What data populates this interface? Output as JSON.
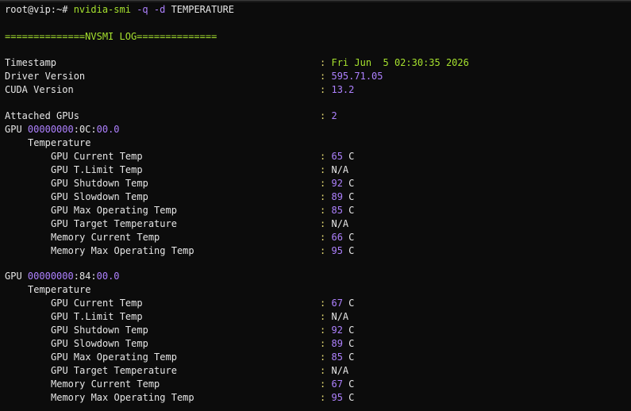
{
  "prompt": {
    "user_host": "root@vip",
    "path_symbol": ":~# ",
    "command": "nvidia-smi",
    "flag_q": "-q",
    "flag_d": "-d",
    "arg": "TEMPERATURE"
  },
  "header": "==============NVSMI LOG==============",
  "timestamp": {
    "label": "Timestamp",
    "value": "Fri Jun  5 02:30:35 2026"
  },
  "driver_version": {
    "label": "Driver Version",
    "value": "595.71.05"
  },
  "cuda_version": {
    "label": "CUDA Version",
    "value": "13.2"
  },
  "attached_gpus": {
    "label": "Attached GPUs",
    "value": "2"
  },
  "colon": ":",
  "gpus": [
    {
      "label": "GPU",
      "bus_prefix": "00000000",
      "bus_mid": ":0C:",
      "bus_suffix": "00.0",
      "section": "Temperature",
      "rows": [
        {
          "label": "GPU Current Temp",
          "num": "65",
          "unit": " C"
        },
        {
          "label": "GPU T.Limit Temp",
          "num": "",
          "unit": "N/A"
        },
        {
          "label": "GPU Shutdown Temp",
          "num": "92",
          "unit": " C"
        },
        {
          "label": "GPU Slowdown Temp",
          "num": "89",
          "unit": " C"
        },
        {
          "label": "GPU Max Operating Temp",
          "num": "85",
          "unit": " C"
        },
        {
          "label": "GPU Target Temperature",
          "num": "",
          "unit": "N/A"
        },
        {
          "label": "Memory Current Temp",
          "num": "66",
          "unit": " C"
        },
        {
          "label": "Memory Max Operating Temp",
          "num": "95",
          "unit": " C"
        }
      ]
    },
    {
      "label": "GPU",
      "bus_prefix": "00000000",
      "bus_mid": ":84:",
      "bus_suffix": "00.0",
      "section": "Temperature",
      "rows": [
        {
          "label": "GPU Current Temp",
          "num": "67",
          "unit": " C"
        },
        {
          "label": "GPU T.Limit Temp",
          "num": "",
          "unit": "N/A"
        },
        {
          "label": "GPU Shutdown Temp",
          "num": "92",
          "unit": " C"
        },
        {
          "label": "GPU Slowdown Temp",
          "num": "89",
          "unit": " C"
        },
        {
          "label": "GPU Max Operating Temp",
          "num": "85",
          "unit": " C"
        },
        {
          "label": "GPU Target Temperature",
          "num": "",
          "unit": "N/A"
        },
        {
          "label": "Memory Current Temp",
          "num": "67",
          "unit": " C"
        },
        {
          "label": "Memory Max Operating Temp",
          "num": "95",
          "unit": " C"
        }
      ]
    }
  ]
}
